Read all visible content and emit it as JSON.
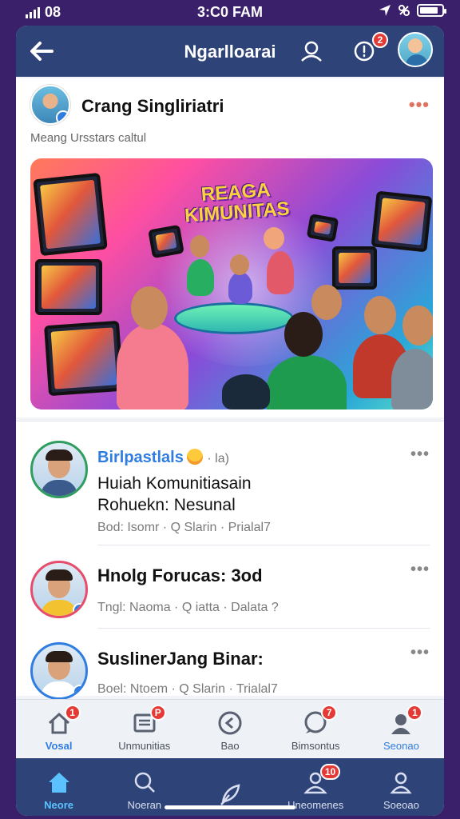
{
  "status": {
    "carrier": "08",
    "time": "3:C0 FAM",
    "battery_level": 0.85
  },
  "header": {
    "title": "Ngarlloarai",
    "back": "back-arrow-icon",
    "profile_icon": "user-outline-icon",
    "notif_badge": "2"
  },
  "post": {
    "author": "Crang Singliriatri",
    "subtitle": "Meang Ursstars caltul",
    "hero_text": "REAGA\nKIMUNITAS"
  },
  "list": [
    {
      "title": "Birlpastlals",
      "title_suffix": "· la)",
      "line1": "Huiah Komunitiasain",
      "line2": "Rohuekn: Nesunal",
      "meta": "Bod: Isomr · Q Slarin · Prialal7",
      "ring": "#2f9d5e"
    },
    {
      "title": "Hnolg Forucas: 3od",
      "meta": "Tngl: Naoma · Q iatta · Dalata ?",
      "ring": "#e84c6c"
    },
    {
      "title": "SuslinerJang Binar:",
      "meta": "Boel: Ntoem · Q Slarin · Trialal7",
      "ring": "#2f7de1"
    }
  ],
  "tabs_top": [
    {
      "label": "Vosal",
      "icon": "home-icon",
      "badge": "1",
      "active": true
    },
    {
      "label": "Unmunitias",
      "icon": "news-icon",
      "badge": "P",
      "active": false
    },
    {
      "label": "Bao",
      "icon": "compass-icon",
      "badge": "",
      "active": false
    },
    {
      "label": "Bimsontus",
      "icon": "chat-icon",
      "badge": "7",
      "active": false
    },
    {
      "label": "Seonao",
      "icon": "profile-icon",
      "badge": "1",
      "active": false
    }
  ],
  "tabs_bottom": [
    {
      "label": "Neore",
      "icon": "home-icon",
      "badge": "",
      "active": true
    },
    {
      "label": "Noeran",
      "icon": "search-icon",
      "badge": "",
      "active": false
    },
    {
      "label": "",
      "icon": "feather-icon",
      "badge": "",
      "active": false
    },
    {
      "label": "Uneomenes",
      "icon": "people-icon",
      "badge": "10",
      "active": false
    },
    {
      "label": "Soeoao",
      "icon": "person-icon",
      "badge": "",
      "active": false
    }
  ]
}
